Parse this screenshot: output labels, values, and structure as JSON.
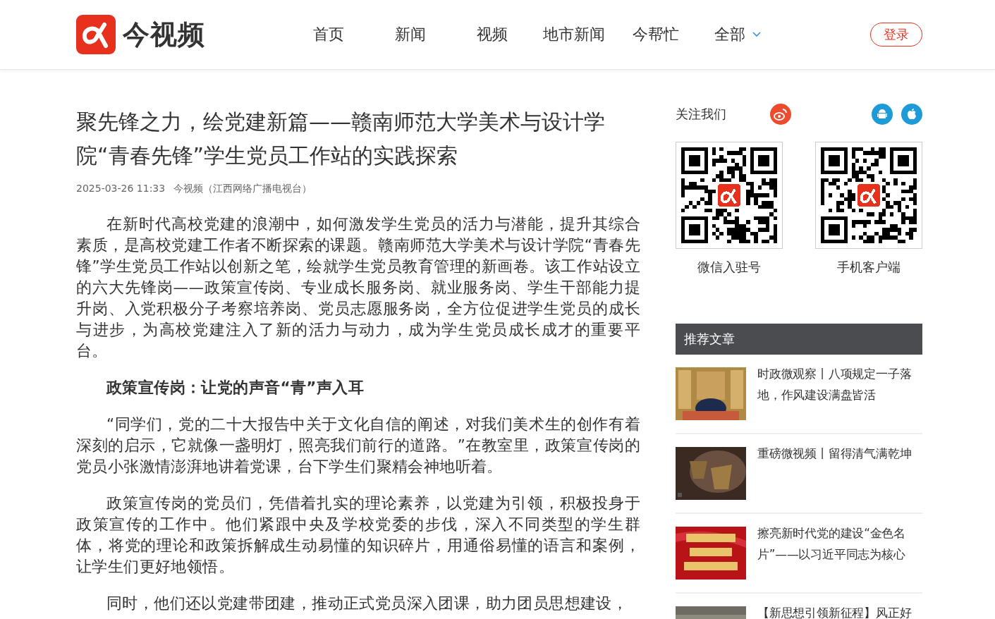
{
  "header": {
    "logo_text": "今视频",
    "nav": [
      {
        "label": "首页",
        "dropdown": false
      },
      {
        "label": "新闻",
        "dropdown": false
      },
      {
        "label": "视频",
        "dropdown": false
      },
      {
        "label": "地市新闻",
        "dropdown": false
      },
      {
        "label": "今帮忙",
        "dropdown": false
      },
      {
        "label": "全部",
        "dropdown": true
      }
    ],
    "login": "登录"
  },
  "article": {
    "title": "聚先锋之力，绘党建新篇——赣南师范大学美术与设计学院“青春先锋”学生党员工作站的实践探索",
    "date": "2025-03-26 11:33",
    "source": "今视频（江西网络广播电视台）",
    "paragraphs": [
      {
        "kind": "text",
        "text": "在新时代高校党建的浪潮中，如何激发学生党员的活力与潜能，提升其综合素质，是高校党建工作者不断探索的课题。赣南师范大学美术与设计学院“青春先锋”学生党员工作站以创新之笔，绘就学生党员教育管理的新画卷。该工作站设立的六大先锋岗——政策宣传岗、专业成长服务岗、就业服务岗、学生干部能力提升岗、入党积极分子考察培养岗、党员志愿服务岗，全方位促进学生党员的成长与进步，为高校党建注入了新的活力与动力，成为学生党员成长成才的重要平台。"
      },
      {
        "kind": "heading",
        "text": "政策宣传岗：让党的声音“青”声入耳"
      },
      {
        "kind": "text",
        "text": "“同学们，党的二十大报告中关于文化自信的阐述，对我们美术生的创作有着深刻的启示，它就像一盏明灯，照亮我们前行的道路。”在教室里，政策宣传岗的党员小张激情澎湃地讲着党课，台下学生们聚精会神地听着。"
      },
      {
        "kind": "text",
        "text": "政策宣传岗的党员们，凭借着扎实的理论素养，以党建为引领，积极投身于政策宣传的工作中。他们紧跟中央及学校党委的步伐，深入不同类型的学生群体，将党的理论和政策拆解成生动易懂的知识碎片，用通俗易懂的语言和案例，让学生们更好地领悟。"
      },
      {
        "kind": "text",
        "text": "同时，他们还以党建带团建，推动正式党员深入团课，助力团员思想建设，"
      }
    ]
  },
  "sidebar": {
    "follow_title": "关注我们",
    "qr_codes": [
      {
        "caption": "微信入驻号"
      },
      {
        "caption": "手机客户端"
      }
    ],
    "recommend_title": "推荐文章",
    "recommended": [
      {
        "title": "时政微观察丨八项规定一子落地，作风建设满盘皆活",
        "kind": "picture"
      },
      {
        "title": "重磅微视频丨留得清气满乾坤",
        "kind": "picture"
      },
      {
        "title": "擦亮新时代党的建设“金色名片”——以习近平同志为核心",
        "kind": "picture"
      },
      {
        "title": "【新思想引领新征程】风正好",
        "kind": "picture"
      }
    ]
  }
}
